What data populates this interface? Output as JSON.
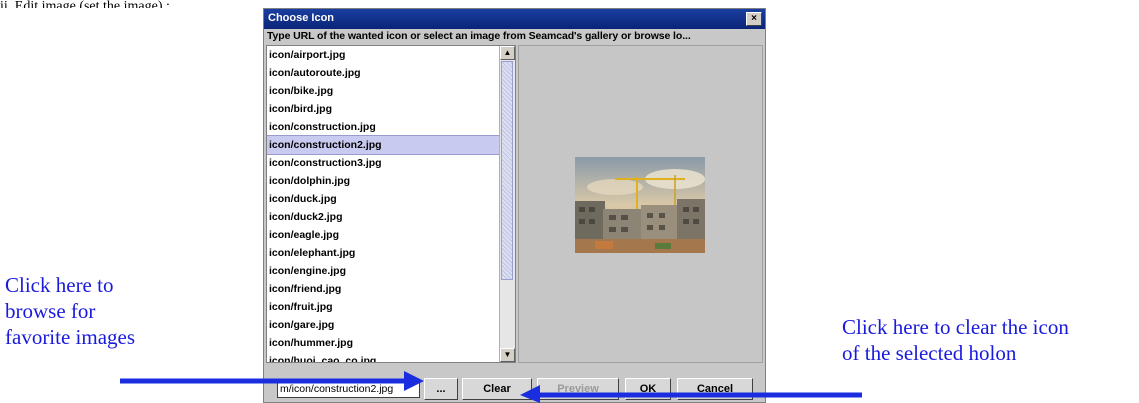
{
  "top_caption": "ii. Edit image (set the image) :",
  "dialog": {
    "title": "Choose Icon",
    "close_glyph": "×",
    "instruction": "Type URL of the wanted icon or select an image from Seamcad's gallery or browse lo...",
    "list": {
      "items": [
        "icon/airport.jpg",
        "icon/autoroute.jpg",
        "icon/bike.jpg",
        "icon/bird.jpg",
        "icon/construction.jpg",
        "icon/construction2.jpg",
        "icon/construction3.jpg",
        "icon/dolphin.jpg",
        "icon/duck.jpg",
        "icon/duck2.jpg",
        "icon/eagle.jpg",
        "icon/elephant.jpg",
        "icon/engine.jpg",
        "icon/friend.jpg",
        "icon/fruit.jpg",
        "icon/gare.jpg",
        "icon/hummer.jpg",
        "icon/huoi_cao_co.jpg"
      ],
      "selected": "icon/construction2.jpg"
    },
    "scroll": {
      "up_glyph": "▲",
      "down_glyph": "▼"
    },
    "url_value": "m/icon/construction2.jpg",
    "buttons": {
      "browse": "...",
      "clear": "Clear",
      "preview": "Preview",
      "ok": "OK",
      "cancel": "Cancel"
    }
  },
  "annotations": {
    "left": "Click here to\nbrowse for\nfavorite images",
    "right": "Click here to clear the icon\nof the selected holon"
  },
  "colors": {
    "titlebar": "#0a2478",
    "annotation_text": "#1a1adc",
    "arrow": "#1a2ee0",
    "selection": "#c9caf0"
  }
}
